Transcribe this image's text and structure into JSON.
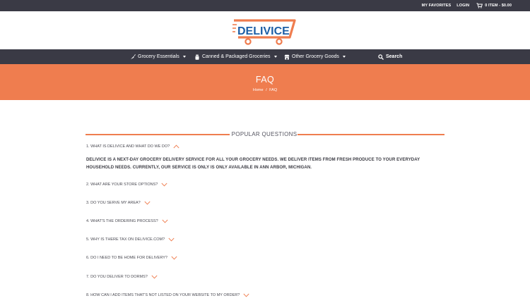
{
  "topbar": {
    "favorites": "MY FAVORITES",
    "login": "LOGIN",
    "cart": "0 ITEM - $0.00"
  },
  "logo": {
    "text": "DELIVICE"
  },
  "nav": {
    "items": [
      {
        "label": "Grocery Essentials",
        "icon": "carrot-icon"
      },
      {
        "label": "Canned & Packaged Groceries",
        "icon": "jar-icon"
      },
      {
        "label": "Other Grocery Goods",
        "icon": "storefront-icon"
      }
    ],
    "search": "Search"
  },
  "banner": {
    "title": "FAQ",
    "breadcrumb": {
      "home": "Home",
      "sep": "/",
      "current": "FAQ"
    }
  },
  "section": {
    "title": "POPULAR QUESTIONS"
  },
  "questions": [
    "1. WHAT IS DELIVICE AND WHAT DO WE DO?",
    "2. WHAT ARE YOUR STORE OPTIONS?",
    "3. DO YOU SERVE MY AREA?",
    "4. WHAT'S THE ORDERING PROCESS?",
    "5. WHY IS THERE TAX ON DELIVICE.COM?",
    "6. DO I NEED TO BE HOME FOR DELIVERY?",
    "7. DO YOU DELIVER TO DORMS?",
    "8. HOW CAN I ADD ITEMS THAT'S NOT LISTED ON YOUR WEBSITE TO MY ORDER?"
  ],
  "answer1": "DELIVICE IS A NEXT-DAY GROCERY DELIVERY SERVICE FOR ALL YOUR GROCERY NEEDS. WE DELIVER ITEMS FROM FRESH PRODUCE TO YOUR EVERYDAY HOUSEHOLD NEEDS. CURRENTLY, OUR SERVICE IS ONLY IS ONLY AVAILABLE IN ANN ARBOR, MICHIGAN.",
  "colors": {
    "accent": "#ef7d4f",
    "dark": "#3a3a45",
    "brandBlue": "#1d5fa6"
  }
}
